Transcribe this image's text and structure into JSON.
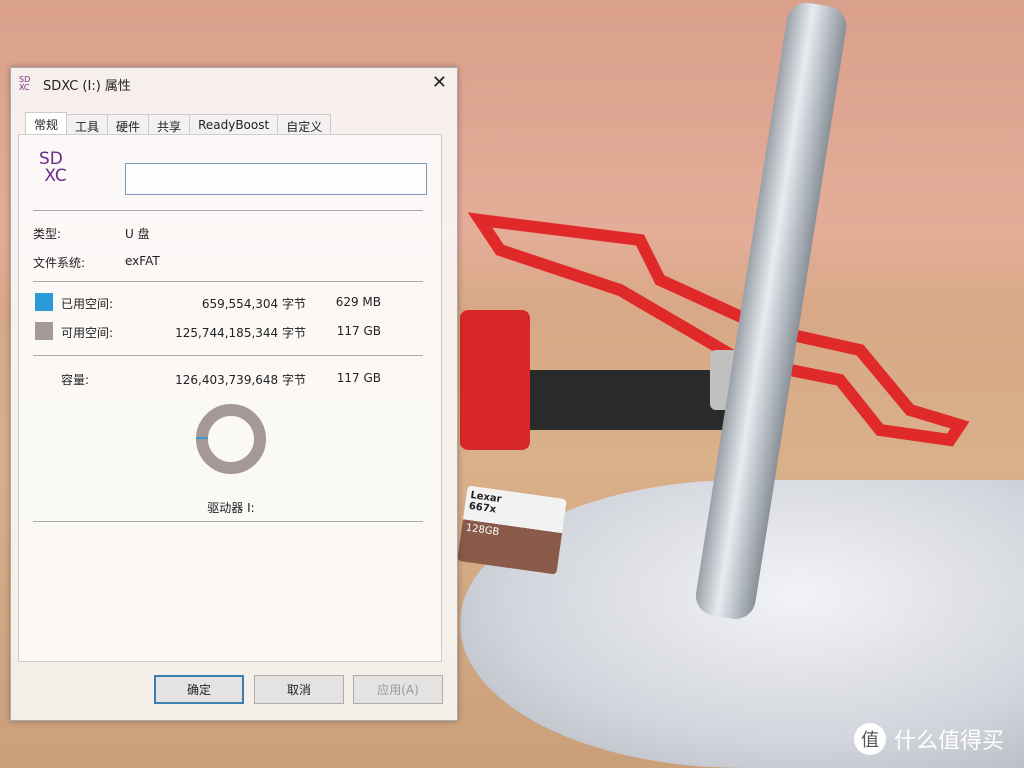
{
  "dialog": {
    "title": "SDXC (I:) 属性",
    "drive_icon_text": "SD XC",
    "tabs": [
      {
        "label": "常规",
        "active": true
      },
      {
        "label": "工具"
      },
      {
        "label": "硬件"
      },
      {
        "label": "共享"
      },
      {
        "label": "ReadyBoost"
      },
      {
        "label": "自定义"
      }
    ],
    "name_value": "",
    "type_label": "类型:",
    "type_value": "U 盘",
    "fs_label": "文件系统:",
    "fs_value": "exFAT",
    "used": {
      "label": "已用空间:",
      "bytes": "659,554,304 字节",
      "size": "629 MB",
      "color": "#2a9ad8"
    },
    "free": {
      "label": "可用空间:",
      "bytes": "125,744,185,344 字节",
      "size": "117 GB",
      "color": "#a59898"
    },
    "capacity": {
      "label": "容量:",
      "bytes": "126,403,739,648 字节",
      "size": "117 GB"
    },
    "used_fraction": 0.0052,
    "drive_label": "驱动器 I:",
    "buttons": {
      "ok": "确定",
      "cancel": "取消",
      "apply": "应用(A)"
    }
  },
  "photo": {
    "card_brand": "Lexar",
    "card_speed": "667x",
    "card_capacity": "128GB"
  },
  "watermark": {
    "icon": "值",
    "text": "什么值得买"
  }
}
